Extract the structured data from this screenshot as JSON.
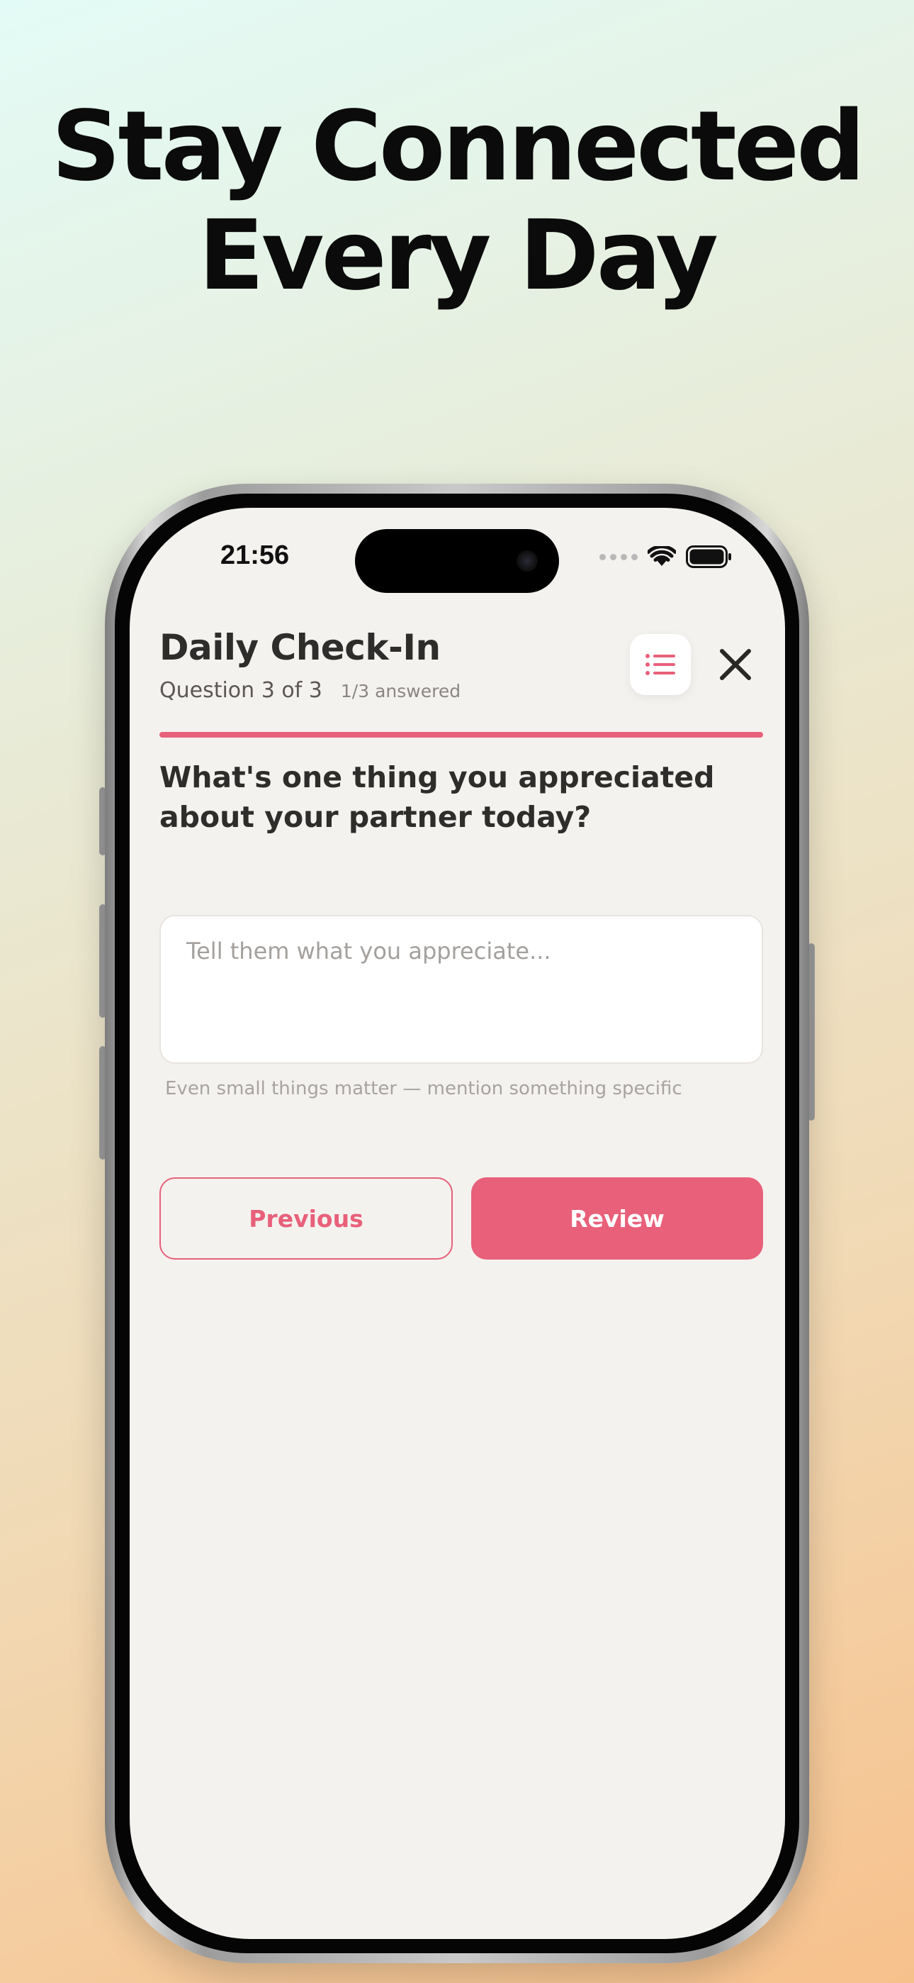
{
  "headline": {
    "line1": "Stay Connected",
    "line2": "Every Day"
  },
  "status_bar": {
    "time": "21:56",
    "icons": [
      "signal-dots",
      "wifi-icon",
      "battery-icon"
    ]
  },
  "header": {
    "title": "Daily Check-In",
    "question_progress": "Question 3 of 3",
    "answered": "1/3 answered",
    "list_icon": "list-icon",
    "close_icon": "close-icon"
  },
  "progress": {
    "fraction": 1.0
  },
  "question": {
    "text": "What's one thing you appreciated about your partner today?"
  },
  "answer": {
    "value": "",
    "placeholder": "Tell them what you appreciate..."
  },
  "hint": "Even small things matter — mention something specific",
  "buttons": {
    "previous": "Previous",
    "review": "Review"
  },
  "colors": {
    "accent": "#e8607a",
    "screen_bg": "#f4f2ef",
    "text_dark": "#2f2d2c"
  }
}
